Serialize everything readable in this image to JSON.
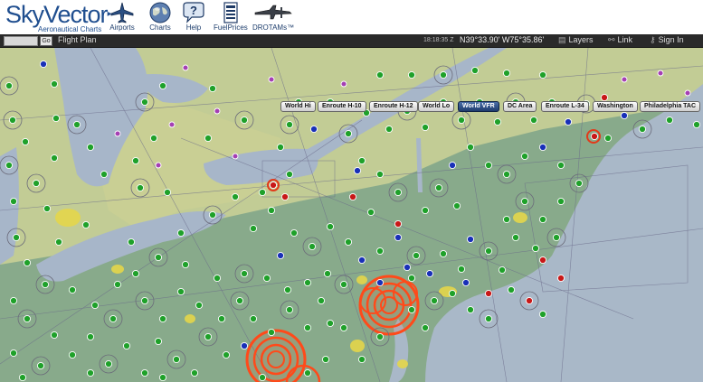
{
  "header": {
    "logo": {
      "name": "SkyVector",
      "tagline": "Aeronautical Charts"
    },
    "nav": [
      {
        "label": "Airports",
        "icon": "airplane-icon"
      },
      {
        "label": "Charts",
        "icon": "globe-icon"
      },
      {
        "label": "Help",
        "icon": "help-icon"
      },
      {
        "label": "FuelPrices",
        "icon": "fuel-prices-icon"
      },
      {
        "label": "DROTAMs™",
        "icon": "drone-icon"
      }
    ]
  },
  "toolbar": {
    "go_label": "Go",
    "flight_plan_label": "Flight Plan",
    "time": "18:18:35 Z",
    "coordinates": "N39°33.90' W75°35.86'",
    "layers_label": "Layers",
    "link_label": "Link",
    "signin_label": "Sign In"
  },
  "chart_buttons": [
    {
      "label": "World Hi",
      "active": false
    },
    {
      "label": "Enroute H-10",
      "active": false
    },
    {
      "label": "Enroute H-12",
      "active": false
    },
    {
      "label": "World Lo",
      "active": false
    },
    {
      "label": "World VFR",
      "active": true
    },
    {
      "label": "DC Area",
      "active": false
    },
    {
      "label": "Enroute L-34",
      "active": false
    },
    {
      "label": "Washington",
      "active": false
    },
    {
      "label": "Philadelphia TAC",
      "active": false
    }
  ],
  "colors": {
    "water": "#aab8c8",
    "land_north": "#c9d29a",
    "land_south": "#86a888",
    "airport_green": "#1fa12a",
    "airport_blue": "#1930b8",
    "airport_red": "#c81818",
    "airport_magenta": "#a43fb3",
    "class_b_ring": "#ff4a1a"
  }
}
